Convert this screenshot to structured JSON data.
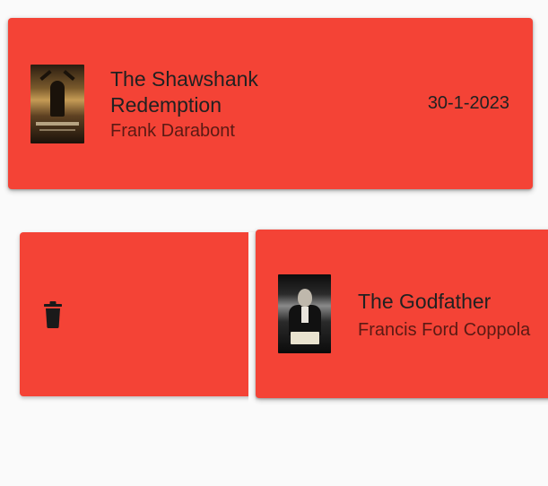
{
  "colors": {
    "card_background": "#f44336",
    "page_background": "#fafafa",
    "title_text": "#212121",
    "subtitle_text": "#5b1a14"
  },
  "movies": [
    {
      "title_line1": "The Shawshank",
      "title_line2": "Redemption",
      "director": "Frank Darabont",
      "date": "30-1-2023",
      "poster_icon": "poster-shawshank"
    },
    {
      "title": "The Godfather",
      "director": "Francis Ford Coppola",
      "poster_icon": "poster-godfather"
    }
  ],
  "swipe_action": {
    "icon": "trash-icon"
  }
}
